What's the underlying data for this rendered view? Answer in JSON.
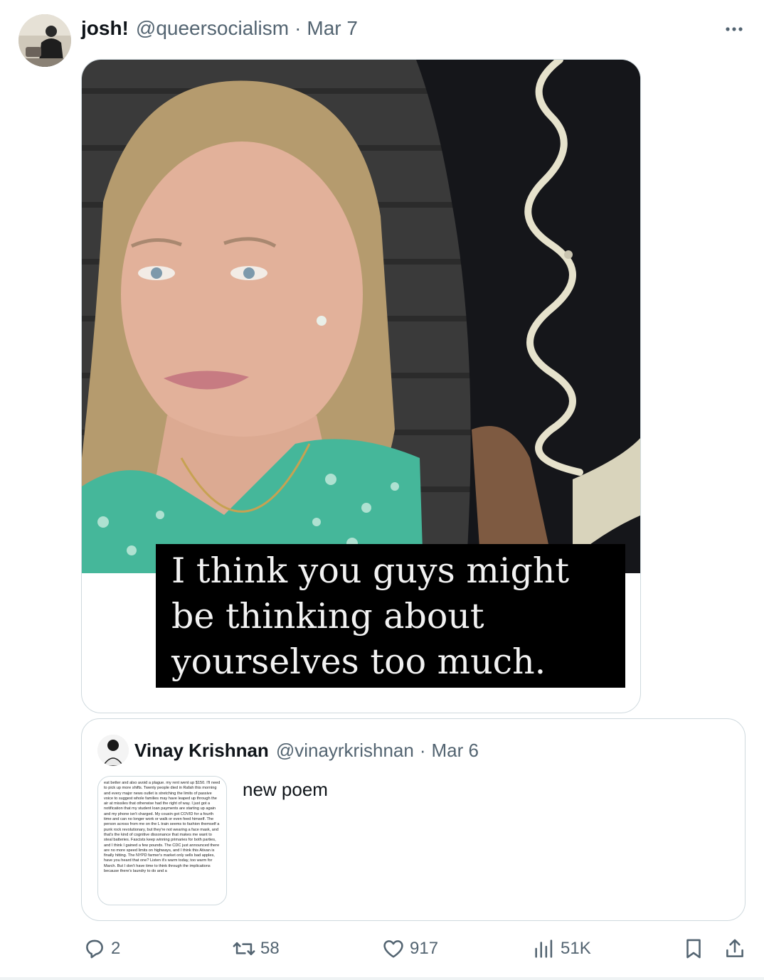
{
  "tweet": {
    "author_name": "josh!",
    "author_handle": "@queersocialism",
    "separator": "·",
    "date": "Mar 7",
    "more_icon": "more-horizontal-icon"
  },
  "media": {
    "caption": "I think you guys might be thinking about yourselves too much."
  },
  "quoted": {
    "author_name": "Vinay Krishnan",
    "author_handle": "@vinayrkrishnan",
    "separator": "·",
    "date": "Mar 6",
    "text": "new poem",
    "thumbnail_text": "eat better and also avoid a plague. my rent went up $150. I'll need to pick up more shifts. Twenty people died in Rafah this morning and every major news outlet is stretching the limits of passive voice to suggest whole families may have leaped up through the air at missiles that otherwise had the right of way. I just got a notification that my student loan payments are starting up again and my phone isn't charged. My cousin got COVID for a fourth time and can no longer work or walk or even feed himself. The person across from me on the L train seems to fashion themself a punk rock revolutionary, but they're not wearing a face mask, and that's the kind of cognitive dissonance that makes me want to steal batteries. Fascists keep winning primaries for both parties, and I think I gained a few pounds. The CDC just announced there are no more speed limits on highways, and I think this Ativan is finally hitting. The NYPD farmer's market only sells bad apples, have you heard that one? Listen it's warm today, too warm for March. But I don't have time to think through the implications because there's laundry to do and a"
  },
  "actions": {
    "replies": "2",
    "reposts": "58",
    "likes": "917",
    "views": "51K"
  },
  "colors": {
    "text_primary": "#0f1419",
    "text_secondary": "#536471",
    "border": "#cfd9de"
  }
}
